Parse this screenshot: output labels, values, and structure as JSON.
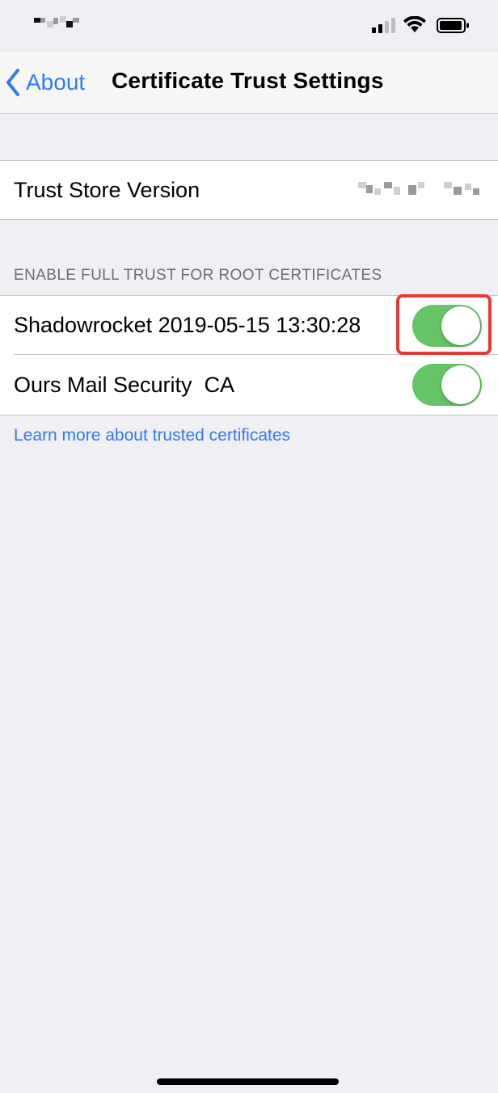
{
  "navbar": {
    "back_label": "About",
    "title": "Certificate Trust Settings"
  },
  "trust_store": {
    "label": "Trust Store Version"
  },
  "root_certs": {
    "header": "ENABLE FULL TRUST FOR ROOT CERTIFICATES",
    "items": [
      {
        "label": "Shadowrocket 2019-05-15 13:30:28",
        "enabled": true
      },
      {
        "label": "Ours Mail Security  CA",
        "enabled": true
      }
    ]
  },
  "learn_more_link": "Learn more about trusted certificates",
  "colors": {
    "accent": "#3478f6",
    "toggle_on": "#65c466",
    "highlight": "#e53935",
    "background": "#efeff4"
  },
  "icons": [
    "chevron-left-icon",
    "signal-icon",
    "wifi-icon",
    "battery-icon"
  ]
}
